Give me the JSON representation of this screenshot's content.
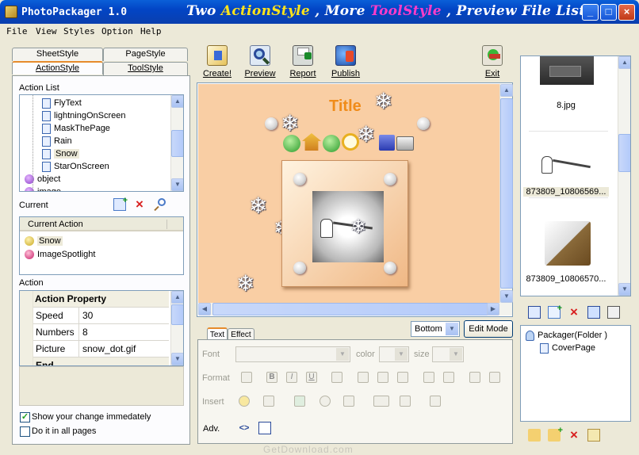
{
  "window": {
    "title": "PhotoPackager 1.0",
    "slogan_parts": [
      "Two ",
      "ActionStyle",
      " , More ",
      "ToolStyle",
      " , Preview File List"
    ],
    "minimize_icon": "_",
    "maximize_icon": "□",
    "close_icon": "×"
  },
  "menu": [
    "File",
    "View",
    "Styles",
    "Option",
    "Help"
  ],
  "left_tabs": {
    "row1": [
      "SheetStyle",
      "PageStyle"
    ],
    "row2": [
      "ActionStyle",
      "ToolStyle"
    ],
    "active": "ActionStyle"
  },
  "action_list": {
    "label": "Action List",
    "items": [
      {
        "label": "FlyText",
        "icon": "doc-icon"
      },
      {
        "label": "lightningOnScreen",
        "icon": "doc-icon"
      },
      {
        "label": "MaskThePage",
        "icon": "doc-icon"
      },
      {
        "label": "Rain",
        "icon": "doc-icon"
      },
      {
        "label": "Snow",
        "icon": "doc-icon"
      },
      {
        "label": "StarOnScreen",
        "icon": "doc-icon"
      },
      {
        "label": "object",
        "icon": "purple-ball-icon"
      },
      {
        "label": "image",
        "icon": "purple-ball-icon"
      }
    ],
    "selected": "Snow"
  },
  "current": {
    "label": "Current",
    "column_header": "Current Action",
    "items": [
      "Snow",
      "ImageSpotlight"
    ]
  },
  "action": {
    "label": "Action",
    "header": "Action Property",
    "collapse_icon": "−",
    "properties": [
      {
        "name": "Speed",
        "value": "30"
      },
      {
        "name": "Numbers",
        "value": "8"
      },
      {
        "name": "Picture",
        "value": "snow_dot.gif"
      },
      {
        "name": "End",
        "value": ""
      }
    ]
  },
  "checkboxes": {
    "show_change": {
      "label": "Show your change immedately",
      "checked": true
    },
    "all_pages": {
      "label": "Do it in all pages",
      "checked": false
    }
  },
  "toolbar": [
    "Create!",
    "Preview",
    "Report",
    "Publish"
  ],
  "exit_label": "Exit",
  "preview": {
    "title": "Title",
    "background": "#f9cea4"
  },
  "position_select": "Bottom",
  "edit_mode_button": "Edit Mode",
  "editor_tabs": [
    "Text",
    "Effect"
  ],
  "editor": {
    "font_label": "Font",
    "color_label": "color",
    "size_label": "size",
    "format_label": "Format",
    "insert_label": "Insert",
    "adv_label": "Adv.",
    "format_glyphs": [
      "B",
      "I",
      "U"
    ]
  },
  "file_list": [
    {
      "name": "8.jpg"
    },
    {
      "name": "873809_10806569..."
    },
    {
      "name": "873809_10806570..."
    }
  ],
  "packager_tree": {
    "root": "Packager(Folder )",
    "child": "CoverPage"
  },
  "watermark": "GetDownload.com"
}
